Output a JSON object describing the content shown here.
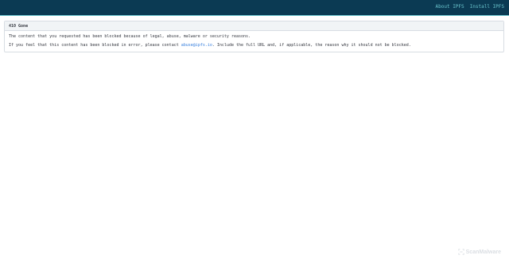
{
  "header": {
    "nav": [
      {
        "label": "About IPFS"
      },
      {
        "label": "Install IPFS"
      }
    ],
    "colors": {
      "bar": "#0b3a53",
      "accent": "#69c4cd"
    }
  },
  "card": {
    "title": "410 Gone",
    "line1": "The content that you requested has been blocked because of legal, abuse, malware or security reasons.",
    "line2_prefix": "If you feel that this content has been blocked in error, please contact ",
    "contact_email": "abuse@ipfs.io",
    "line2_suffix": ". Include the full URL and, if applicable, the reason why it should not be blocked."
  },
  "watermark": {
    "label": "ScanMalware",
    "icon": "scanmalware-logo-icon"
  }
}
